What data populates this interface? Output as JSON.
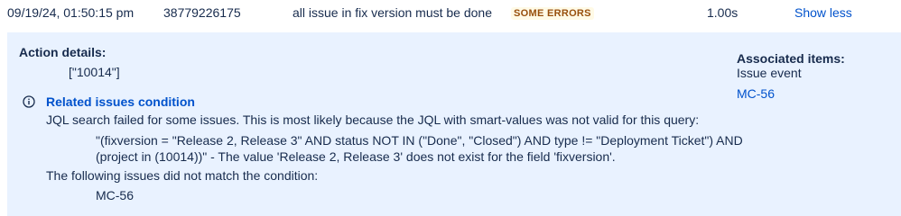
{
  "row": {
    "date": "09/19/24, 01:50:15 pm",
    "id": "38779226175",
    "rule": "all issue in fix version must be done",
    "status": "SOME ERRORS",
    "duration": "1.00s",
    "toggle": "Show less"
  },
  "details": {
    "action_title": "Action details:",
    "action_value": "[\"10014\"]",
    "condition_title": "Related issues condition",
    "jql_message": "JQL search failed for some issues. This is most likely because the JQL with smart-values was not valid for this query:",
    "query_line1": "\"(fixversion = \"Release 2, Release 3\" AND status NOT IN (\"Done\", \"Closed\") AND type != \"Deployment Ticket\") AND",
    "query_line2": "(project in (10014))\" - The value 'Release 2, Release 3' does not exist for the field 'fixversion'.",
    "not_match": "The following issues did not match the condition:",
    "not_match_issue": "MC-56",
    "associated_title": "Associated items:",
    "associated_type": "Issue event",
    "associated_link": "MC-56"
  },
  "icons": {
    "info": "info-circle-icon"
  },
  "colors": {
    "link": "#0052cc",
    "status_text": "#974f0c",
    "status_bg": "#fffae6",
    "details_bg": "#e9f2ff"
  }
}
